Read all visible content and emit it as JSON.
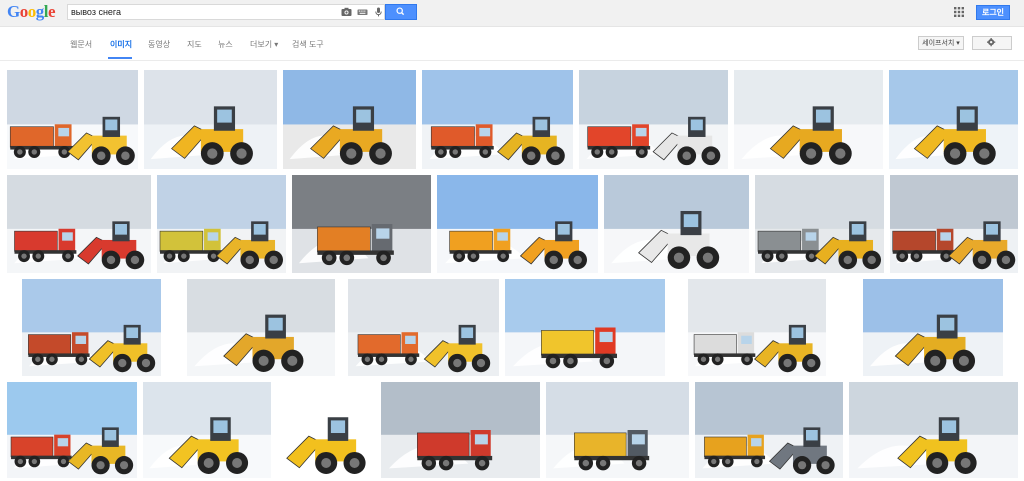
{
  "logo": "Google",
  "search": {
    "query": "вывоз снега"
  },
  "header": {
    "login_label": "로그인"
  },
  "tabs": [
    {
      "label": "웹문서",
      "active": false
    },
    {
      "label": "이미지",
      "active": true
    },
    {
      "label": "동영상",
      "active": false
    },
    {
      "label": "지도",
      "active": false
    },
    {
      "label": "뉴스",
      "active": false
    },
    {
      "label": "더보기 ▾",
      "active": false
    },
    {
      "label": "검색 도구",
      "active": false
    }
  ],
  "toolbar": {
    "safesearch_label": "세이프서치 ▾"
  },
  "colors": {
    "accent": "#4d90fe",
    "accent_border": "#3079ed",
    "active_tab": "#1a73e8"
  },
  "results": [
    {
      "kind": "loader-truck",
      "sky": "#cfd8e3",
      "body": "#e0672a",
      "machine": "#f2c230",
      "snow": "#f7f9fb"
    },
    {
      "kind": "loader",
      "sky": "#dde3ea",
      "body": "#f0b521",
      "machine": "#f0b521",
      "snow": "#eef2f6"
    },
    {
      "kind": "loader",
      "sky": "#8fb8e6",
      "body": "#e9a922",
      "machine": "#e9a922",
      "snow": "#e9e9e9"
    },
    {
      "kind": "loader-truck",
      "sky": "#9fc3ea",
      "body": "#e05a2a",
      "machine": "#e6b422",
      "snow": "#f0f3f6"
    },
    {
      "kind": "loader-truck",
      "sky": "#c7d3df",
      "body": "#e2452a",
      "machine": "#e6e6e6",
      "snow": "#f3f5f7"
    },
    {
      "kind": "loader",
      "sky": "#e6ebef",
      "body": "#e7a920",
      "machine": "#e7a920",
      "snow": "#f7f8fa"
    },
    {
      "kind": "loader",
      "sky": "#a6c8ea",
      "body": "#efb821",
      "machine": "#efb821",
      "snow": "#eef3f8"
    },
    {
      "kind": "loader-truck",
      "sky": "#d5dbe1",
      "body": "#d83a2e",
      "machine": "#d83a2e",
      "snow": "#f4f6f8"
    },
    {
      "kind": "loader-truck",
      "sky": "#c0d2e6",
      "body": "#d2c23a",
      "machine": "#e9b428",
      "snow": "#f1f3f5"
    },
    {
      "kind": "truck",
      "sky": "#7b7f84",
      "body": "#e37f24",
      "machine": "#666a70",
      "snow": "#dfe2e6"
    },
    {
      "kind": "loader-truck",
      "sky": "#8ab7ea",
      "body": "#f0a020",
      "machine": "#f0a020",
      "snow": "#f5f7fa"
    },
    {
      "kind": "loader",
      "sky": "#b9c9da",
      "body": "#e8e8e8",
      "machine": "#3b3b3b",
      "snow": "#f6f7f9"
    },
    {
      "kind": "loader-truck",
      "sky": "#d6dce2",
      "body": "#8a8f92",
      "machine": "#e8b01f",
      "snow": "#e6e9ec"
    },
    {
      "kind": "loader-truck",
      "sky": "#bfc8d2",
      "body": "#b5472c",
      "machine": "#e8a92a",
      "snow": "#eef1f4"
    },
    {
      "kind": "loader-truck",
      "sky": "#aac9ea",
      "body": "#c44a2a",
      "machine": "#f0c028",
      "snow": "#eef1f4"
    },
    {
      "kind": "loader",
      "sky": "#d8dde2",
      "body": "#e3a72a",
      "machine": "#e3a72a",
      "snow": "#f4f6f8"
    },
    {
      "kind": "loader-truck",
      "sky": "#e0e4e9",
      "body": "#e26a2c",
      "machine": "#f0c12a",
      "snow": "#eceff2"
    },
    {
      "kind": "truck",
      "sky": "#a8cbed",
      "body": "#f0c52c",
      "machine": "#e03a24",
      "snow": "#f4f6f9"
    },
    {
      "kind": "loader-truck",
      "sky": "#e3e7eb",
      "body": "#dcdcdc",
      "machine": "#e8b424",
      "snow": "#f7f8fa"
    },
    {
      "kind": "loader",
      "sky": "#9cc0e8",
      "body": "#e4ad22",
      "machine": "#e4ad22",
      "snow": "#eef2f6"
    },
    {
      "kind": "loader-truck",
      "sky": "#9cc9ee",
      "body": "#d8432a",
      "machine": "#e8b725",
      "snow": "#f3f5f8"
    },
    {
      "kind": "loader",
      "sky": "#dce4ec",
      "body": "#f2c322",
      "machine": "#f2c322",
      "snow": "#f7f9fb"
    },
    {
      "kind": "loader",
      "sky": "#ffffff",
      "body": "#f2c01e",
      "machine": "#f2c01e",
      "snow": "#ffffff"
    },
    {
      "kind": "truck",
      "sky": "#b3bec9",
      "body": "#cf3a2c",
      "machine": "#cf3a2c",
      "snow": "#e9ecef"
    },
    {
      "kind": "truck",
      "sky": "#d5dde6",
      "body": "#e8b42a",
      "machine": "#525a63",
      "snow": "#f5f7f9"
    },
    {
      "kind": "loader-truck",
      "sky": "#b7c5d3",
      "body": "#e7a21e",
      "machine": "#707780",
      "snow": "#eff2f5"
    },
    {
      "kind": "loader",
      "sky": "#cdd6de",
      "body": "#f0c21f",
      "machine": "#555b61",
      "snow": "#f3f5f8"
    }
  ]
}
